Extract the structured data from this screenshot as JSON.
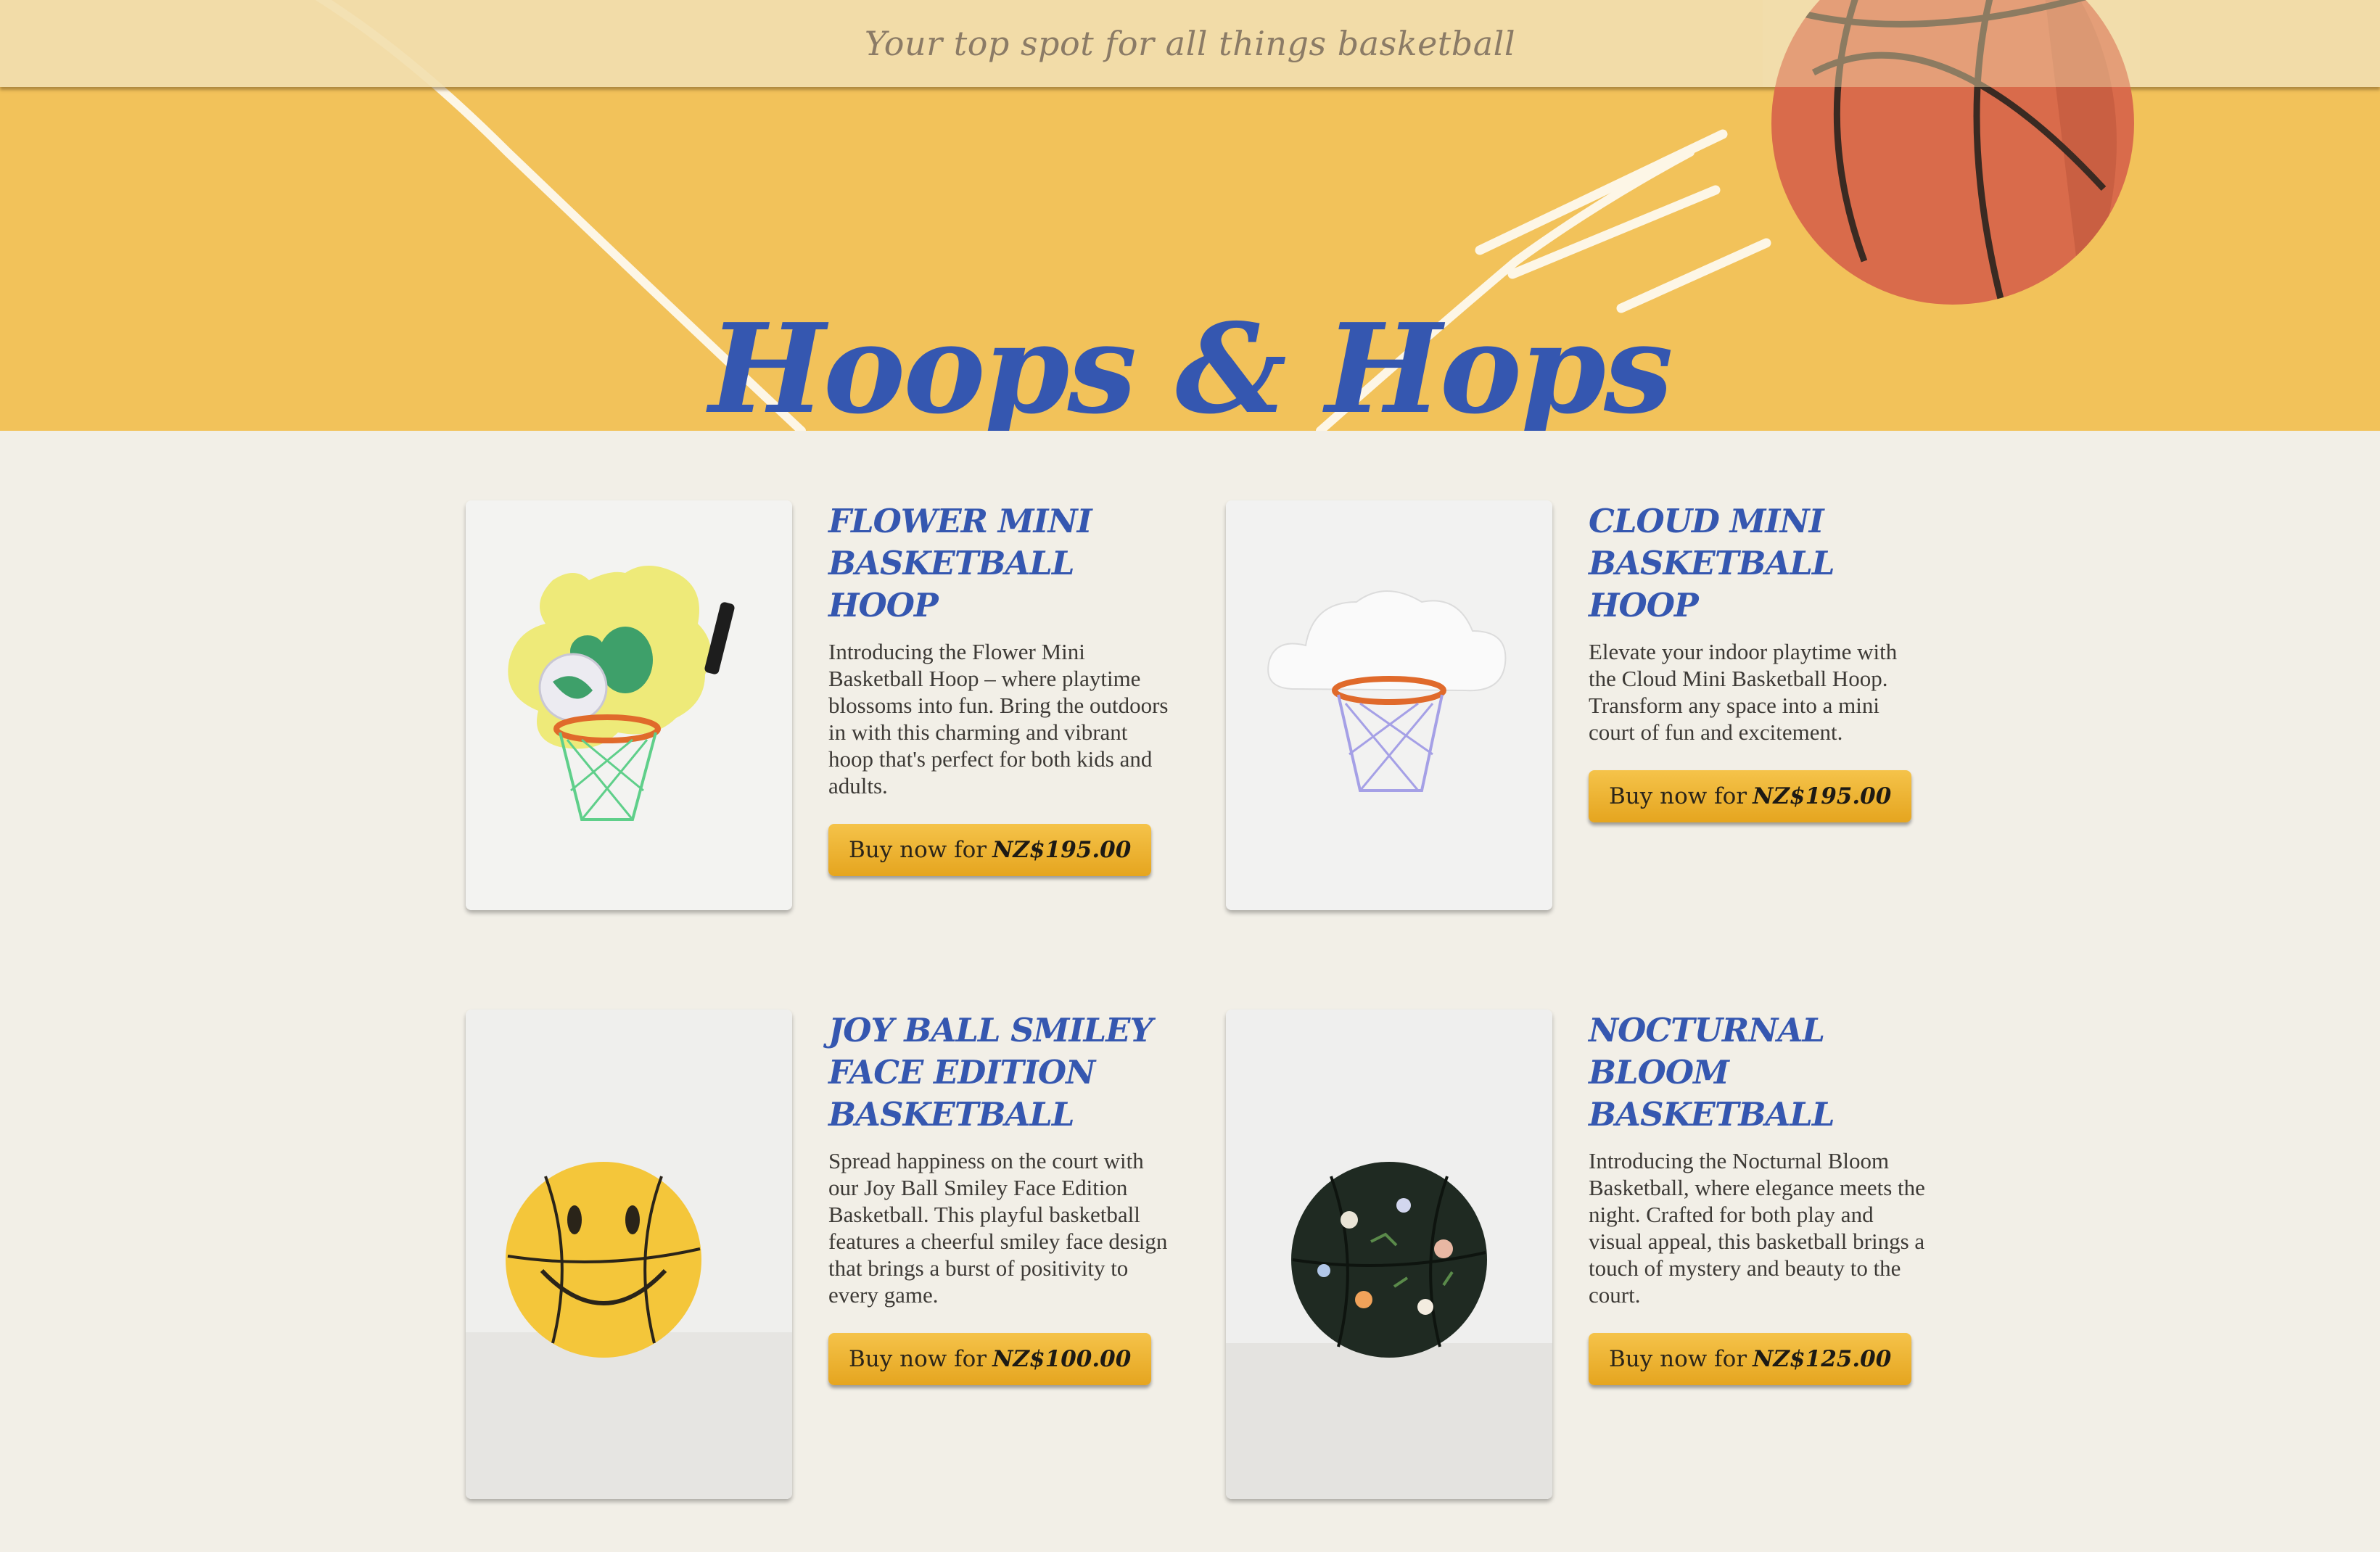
{
  "header": {
    "tagline": "Your top spot for all things basketball",
    "title": "Hoops & Hops"
  },
  "colors": {
    "hero_background": "#f2c25a",
    "title_blue": "#3557b0",
    "button_gold": "#eab43a",
    "page_background": "#f2efe7"
  },
  "products": [
    {
      "name": "Flower Mini Basketball Hoop",
      "description": "Introducing the Flower Mini Basketball Hoop – where playtime blossoms into fun. Bring the outdoors in with this charming and vibrant hoop that's perfect for both kids and adults.",
      "buy_label": "Buy now for",
      "price": "NZ$195.00",
      "image_icon": "flower-hoop-image"
    },
    {
      "name": "Cloud Mini Basketball Hoop",
      "description": "Elevate your indoor playtime with the Cloud Mini Basketball Hoop. Transform any space into a mini court of fun and excitement.",
      "buy_label": "Buy now for",
      "price": "NZ$195.00",
      "image_icon": "cloud-hoop-image"
    },
    {
      "name": "Joy Ball Smiley Face Edition Basketball",
      "description": "Spread happiness on the court with our Joy Ball Smiley Face Edition Basketball. This playful basketball features a cheerful smiley face design that brings a burst of positivity to every game.",
      "buy_label": "Buy now for",
      "price": "NZ$100.00",
      "image_icon": "smiley-ball-image"
    },
    {
      "name": "Nocturnal Bloom Basketball",
      "description": "Introducing the Nocturnal Bloom Basketball, where elegance meets the night. Crafted for both play and visual appeal, this basketball brings a touch of mystery and beauty to the court.",
      "buy_label": "Buy now for",
      "price": "NZ$125.00",
      "image_icon": "floral-ball-image"
    }
  ]
}
